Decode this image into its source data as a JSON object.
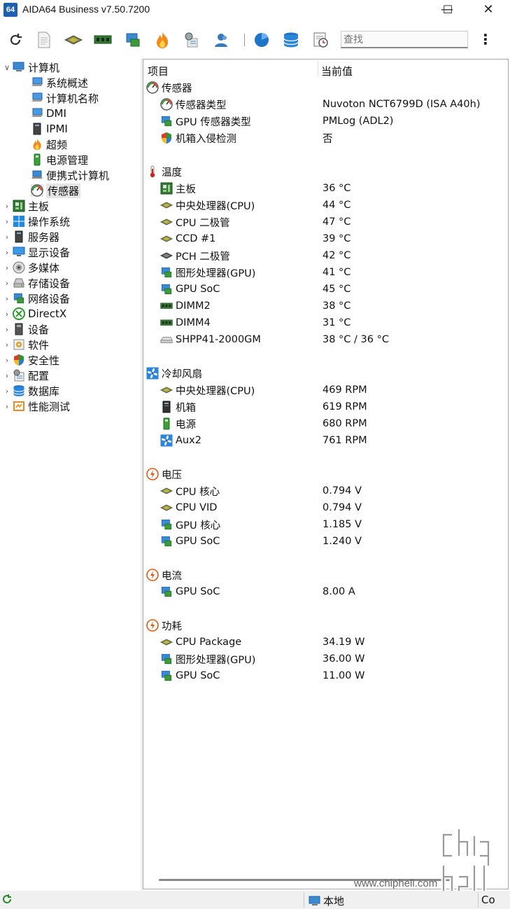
{
  "window": {
    "logo_text": "64",
    "title": "AIDA64 Business v7.50.7200",
    "controls": {
      "minimize": "—",
      "maximize": "☐",
      "close": "✕"
    }
  },
  "toolbar": {
    "buttons": [
      "refresh-icon",
      "report-icon",
      "cpu-icon",
      "memory-icon",
      "network-icon",
      "flame-icon",
      "tools-icon",
      "user-icon",
      "clock-pie-icon",
      "database-icon",
      "schedule-icon"
    ],
    "search_placeholder": "查找",
    "menu_label": "⋮"
  },
  "tree": {
    "root": {
      "label": "计算机",
      "expanded": true
    },
    "children": [
      {
        "label": "系统概述"
      },
      {
        "label": "计算机名称"
      },
      {
        "label": "DMI"
      },
      {
        "label": "IPMI"
      },
      {
        "label": "超频"
      },
      {
        "label": "电源管理"
      },
      {
        "label": "便携式计算机"
      },
      {
        "label": "传感器",
        "selected": true
      }
    ],
    "top_items": [
      {
        "label": "主板"
      },
      {
        "label": "操作系统"
      },
      {
        "label": "服务器"
      },
      {
        "label": "显示设备"
      },
      {
        "label": "多媒体"
      },
      {
        "label": "存储设备"
      },
      {
        "label": "网络设备"
      },
      {
        "label": "DirectX"
      },
      {
        "label": "设备"
      },
      {
        "label": "软件"
      },
      {
        "label": "安全性"
      },
      {
        "label": "配置"
      },
      {
        "label": "数据库"
      },
      {
        "label": "性能测试"
      }
    ]
  },
  "columns": {
    "item": "项目",
    "value": "当前值"
  },
  "groups": [
    {
      "title": "传感器",
      "icon": "gauge-icon",
      "rows": [
        {
          "label": "传感器类型",
          "value": "Nuvoton NCT6799D  (ISA A40h)",
          "icon": "gauge-icon"
        },
        {
          "label": "GPU 传感器类型",
          "value": "PMLog  (ADL2)",
          "icon": "gpu-icon"
        },
        {
          "label": "机箱入侵检测",
          "value": "否",
          "icon": "shield-icon"
        }
      ]
    },
    {
      "title": "温度",
      "icon": "thermometer-icon",
      "rows": [
        {
          "label": "主板",
          "value": "36 °C",
          "icon": "motherboard-icon"
        },
        {
          "label": "中央处理器(CPU)",
          "value": "44 °C",
          "icon": "cpu-icon"
        },
        {
          "label": "CPU 二极管",
          "value": "47 °C",
          "icon": "cpu-icon"
        },
        {
          "label": "CCD #1",
          "value": "39 °C",
          "icon": "cpu-icon"
        },
        {
          "label": "PCH 二极管",
          "value": "42 °C",
          "icon": "chip-icon"
        },
        {
          "label": "图形处理器(GPU)",
          "value": "41 °C",
          "icon": "gpu-icon"
        },
        {
          "label": "GPU SoC",
          "value": "45 °C",
          "icon": "gpu-icon"
        },
        {
          "label": "DIMM2",
          "value": "38 °C",
          "icon": "memory-icon"
        },
        {
          "label": "DIMM4",
          "value": "31 °C",
          "icon": "memory-icon"
        },
        {
          "label": "SHPP41-2000GM",
          "value": "38 °C / 36 °C",
          "icon": "disk-icon"
        }
      ]
    },
    {
      "title": "冷却风扇",
      "icon": "fan-icon",
      "rows": [
        {
          "label": "中央处理器(CPU)",
          "value": "469 RPM",
          "icon": "cpu-icon"
        },
        {
          "label": "机箱",
          "value": "619 RPM",
          "icon": "case-icon"
        },
        {
          "label": "电源",
          "value": "680 RPM",
          "icon": "power-supply-icon"
        },
        {
          "label": "Aux2",
          "value": "761 RPM",
          "icon": "fan-icon"
        }
      ]
    },
    {
      "title": "电压",
      "icon": "bolt-icon",
      "rows": [
        {
          "label": "CPU 核心",
          "value": "0.794 V",
          "icon": "cpu-icon"
        },
        {
          "label": "CPU VID",
          "value": "0.794 V",
          "icon": "cpu-icon"
        },
        {
          "label": "GPU 核心",
          "value": "1.185 V",
          "icon": "gpu-icon"
        },
        {
          "label": "GPU SoC",
          "value": "1.240 V",
          "icon": "gpu-icon"
        }
      ]
    },
    {
      "title": "电流",
      "icon": "bolt-icon",
      "rows": [
        {
          "label": "GPU SoC",
          "value": "8.00 A",
          "icon": "gpu-icon"
        }
      ]
    },
    {
      "title": "功耗",
      "icon": "bolt-icon",
      "rows": [
        {
          "label": "CPU Package",
          "value": "34.19 W",
          "icon": "cpu-icon"
        },
        {
          "label": "图形处理器(GPU)",
          "value": "36.00 W",
          "icon": "gpu-icon"
        },
        {
          "label": "GPU SoC",
          "value": "11.00 W",
          "icon": "gpu-icon"
        }
      ]
    }
  ],
  "status": {
    "local": "本地",
    "right": "Co"
  },
  "watermark": {
    "url": "www.chiphell.com",
    "logo_top": "chip",
    "logo_bottom": "hell"
  },
  "colors": {
    "accent": "#1f5fb0",
    "selection": "#e5e5e5",
    "chip_green": "#3a8a3a"
  }
}
